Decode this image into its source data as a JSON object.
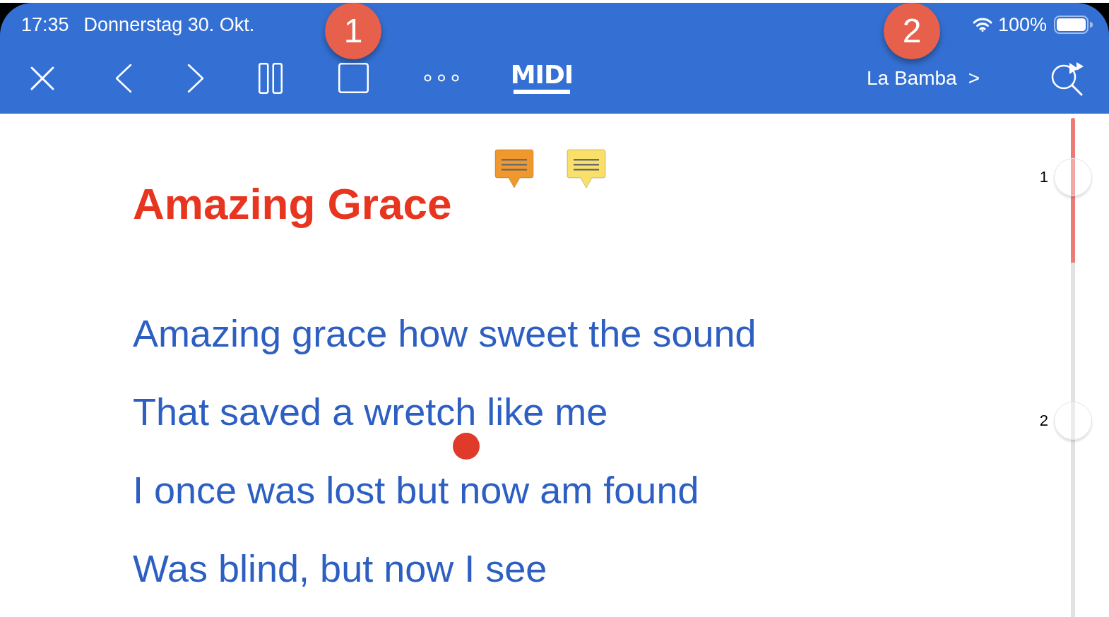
{
  "status_bar": {
    "time": "17:35",
    "date": "Donnerstag 30. Okt.",
    "battery": "100%"
  },
  "toolbar": {
    "logo": "MIDI",
    "next_song": {
      "title": "La Bamba",
      "arrow": ">"
    }
  },
  "callouts": [
    {
      "label": "1"
    },
    {
      "label": "2"
    }
  ],
  "notes": [
    {
      "color": "#f0982e"
    },
    {
      "color": "#f9e06a"
    }
  ],
  "song": {
    "title": "Amazing Grace",
    "lines": [
      "Amazing grace how sweet the sound",
      "That saved a wretch like me",
      "I once was lost but now am found",
      "Was blind, but now I see"
    ]
  },
  "scrubber": {
    "level": 0.29,
    "markers": [
      {
        "label": "1"
      },
      {
        "label": "2"
      }
    ]
  }
}
